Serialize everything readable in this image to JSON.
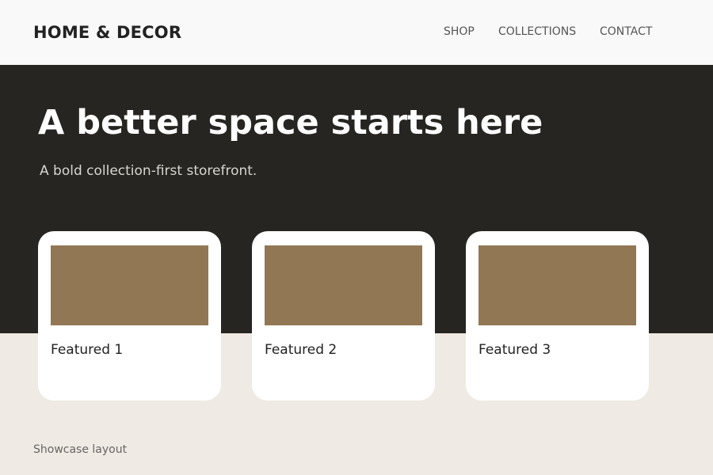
{
  "header": {
    "brand": "HOME & DECOR",
    "nav": [
      "SHOP",
      "COLLECTIONS",
      "CONTACT"
    ]
  },
  "hero": {
    "title": "A better space starts here",
    "subtitle": "A bold collection-first storefront."
  },
  "cards": [
    {
      "title": "Featured 1"
    },
    {
      "title": "Featured 2"
    },
    {
      "title": "Featured 3"
    }
  ],
  "footer": {
    "note": "Showcase layout"
  },
  "colors": {
    "header_bg": "#f9f9f9",
    "hero_bg": "#262521",
    "page_bg": "#efeae3",
    "card_image": "#927755",
    "card_bg": "#ffffff"
  }
}
